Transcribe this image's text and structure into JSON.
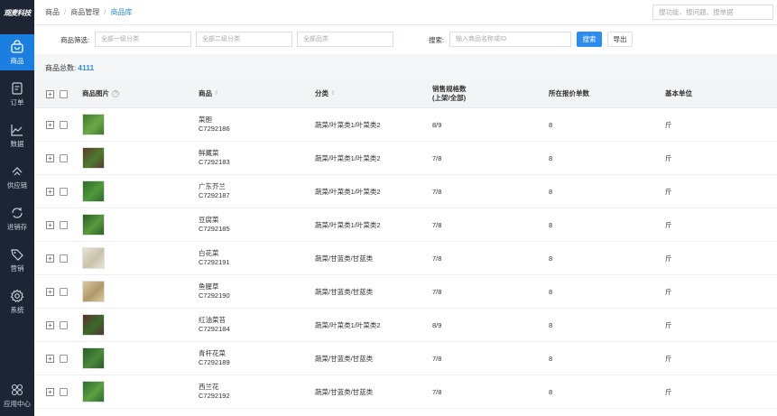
{
  "app": {
    "logo_text": "观麦科技"
  },
  "sidebar": {
    "items": [
      {
        "label": "商品",
        "icon": "bag-icon",
        "active": true
      },
      {
        "label": "订单",
        "icon": "order-icon",
        "active": false
      },
      {
        "label": "数据",
        "icon": "chart-icon",
        "active": false
      },
      {
        "label": "供应链",
        "icon": "supply-chain-icon",
        "active": false
      },
      {
        "label": "进销存",
        "icon": "inventory-icon",
        "active": false
      },
      {
        "label": "营销",
        "icon": "tag-icon",
        "active": false
      },
      {
        "label": "系统",
        "icon": "gear-icon",
        "active": false
      }
    ],
    "bottom_item": {
      "label": "应用中心",
      "icon": "app-center-icon"
    }
  },
  "breadcrumb": {
    "items": [
      "商品",
      "商品管理",
      "商品库"
    ],
    "separator": "/"
  },
  "top_search": {
    "placeholder": "搜功能、搜问题、搜单据"
  },
  "filter": {
    "label": "商品筛选:",
    "category1_placeholder": "全部一级分类",
    "category2_placeholder": "全部二级分类",
    "pinlei_placeholder": "全部品类",
    "search_label": "搜索:",
    "search_placeholder": "输入商品名称或ID",
    "search_button": "搜索",
    "export_button": "导出"
  },
  "summary": {
    "label": "商品总数:",
    "count": "4111"
  },
  "table": {
    "columns": {
      "image": "商品图片",
      "product": "商品",
      "category": "分类",
      "spec_line1": "销售规格数",
      "spec_line2": "(上架/全部)",
      "quote_count": "所在报价单数",
      "unit": "基本单位"
    },
    "rows": [
      {
        "name": "菜胆",
        "id": "C7292186",
        "category": "蔬菜/叶菜类1/叶菜类2",
        "spec": "8/9",
        "quotes": "8",
        "unit": "斤",
        "image": "菜胆"
      },
      {
        "name": "鲜藏菜",
        "id": "C7292183",
        "category": "蔬菜/叶菜类1/叶菜类2",
        "spec": "7/8",
        "quotes": "8",
        "unit": "斤",
        "image": "鲜藏菜"
      },
      {
        "name": "广东芥兰",
        "id": "C7292187",
        "category": "蔬菜/叶菜类1/叶菜类2",
        "spec": "7/8",
        "quotes": "8",
        "unit": "斤",
        "image": "广东芥兰"
      },
      {
        "name": "豆腐菜",
        "id": "C7292185",
        "category": "蔬菜/叶菜类1/叶菜类2",
        "spec": "7/8",
        "quotes": "8",
        "unit": "斤",
        "image": "豆腐菜"
      },
      {
        "name": "白花菜",
        "id": "C7292191",
        "category": "蔬菜/甘蓝类/甘蓝类",
        "spec": "7/8",
        "quotes": "8",
        "unit": "斤",
        "image": "白花菜"
      },
      {
        "name": "鱼腥草",
        "id": "C7292190",
        "category": "蔬菜/甘蓝类/甘蓝类",
        "spec": "7/8",
        "quotes": "8",
        "unit": "斤",
        "image": "鱼腥草"
      },
      {
        "name": "红油菜苔",
        "id": "C7292184",
        "category": "蔬菜/叶菜类1/叶菜类2",
        "spec": "8/9",
        "quotes": "8",
        "unit": "斤",
        "image": "红油菜苔"
      },
      {
        "name": "青杆花菜",
        "id": "C7292189",
        "category": "蔬菜/甘蓝类/甘蓝类",
        "spec": "7/8",
        "quotes": "8",
        "unit": "斤",
        "image": "青杆花菜"
      },
      {
        "name": "西兰花",
        "id": "C7292192",
        "category": "蔬菜/甘蓝类/甘蓝类",
        "spec": "7/8",
        "quotes": "8",
        "unit": "斤",
        "image": "西兰花"
      }
    ]
  },
  "colors": {
    "sidebar_bg": "#1d2535",
    "accent": "#2d8cf0",
    "active_nav": "#1a7fe0"
  }
}
